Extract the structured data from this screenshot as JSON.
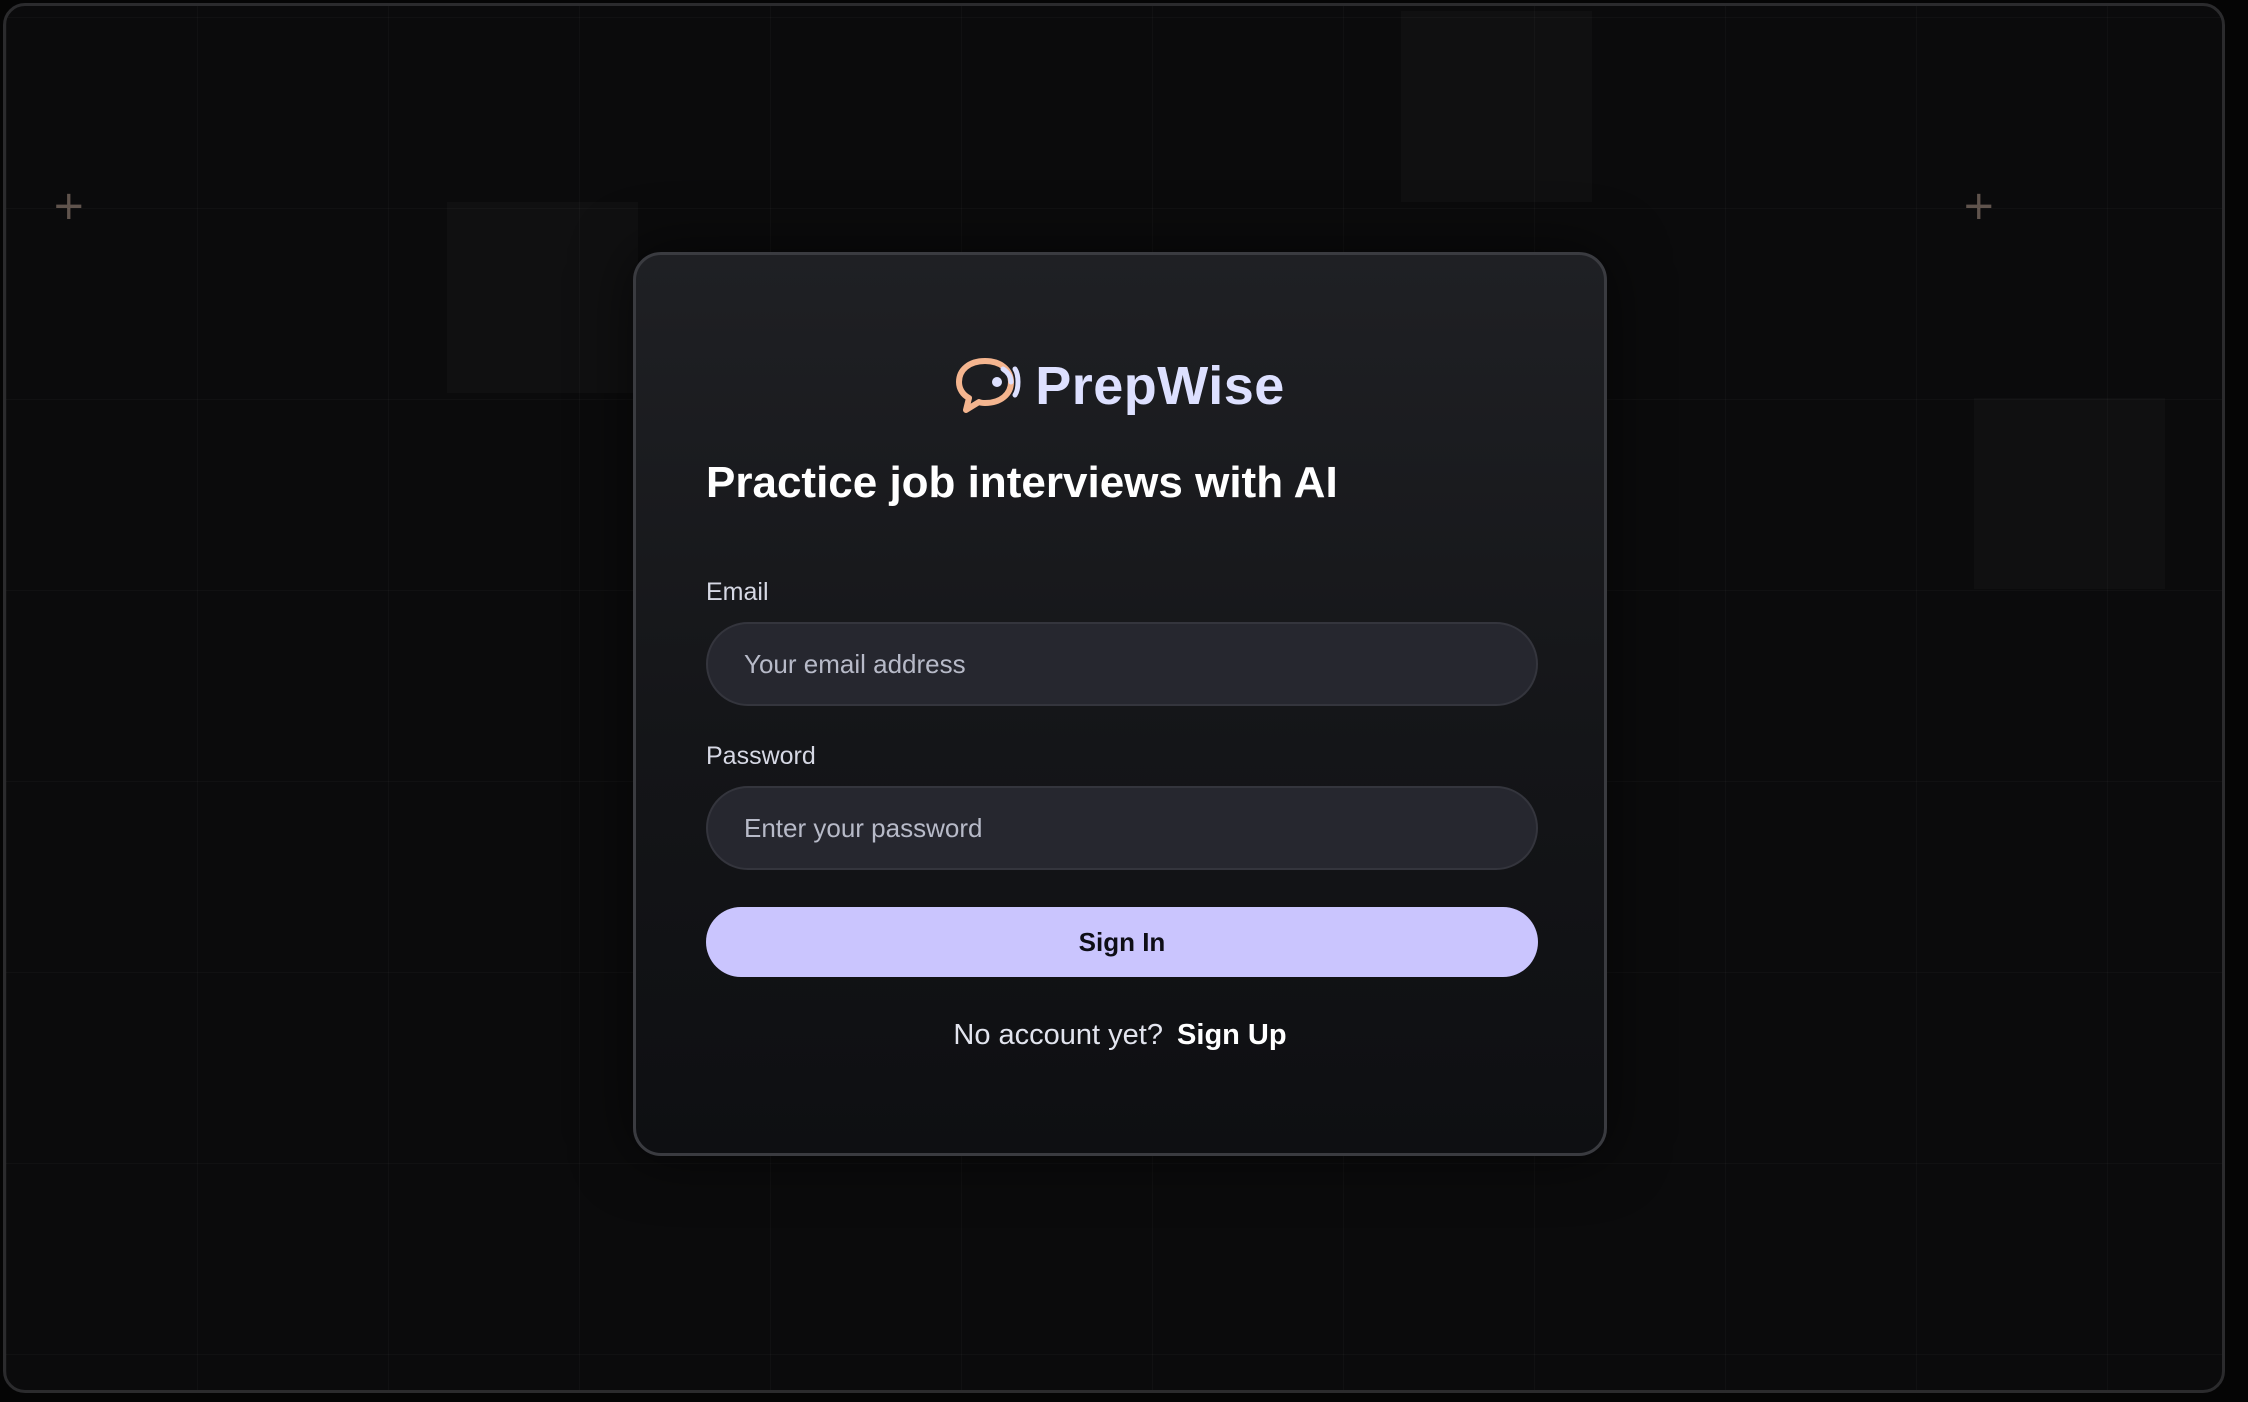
{
  "brand": {
    "name": "PrepWise",
    "logo_icon": "speech-bubble-icon",
    "accent_color": "#f4b58f",
    "text_color": "#dde0ff"
  },
  "auth": {
    "headline": "Practice job interviews with AI",
    "email": {
      "label": "Email",
      "placeholder": "Your email address",
      "value": ""
    },
    "password": {
      "label": "Password",
      "placeholder": "Enter your password",
      "value": ""
    },
    "submit_label": "Sign In",
    "switch_prompt": "No account yet?",
    "switch_link": "Sign Up",
    "button_color": "#cac5fe"
  },
  "decor": {
    "sparkle_icon": "sparkle-icon",
    "sparkle_glyph": "+"
  }
}
